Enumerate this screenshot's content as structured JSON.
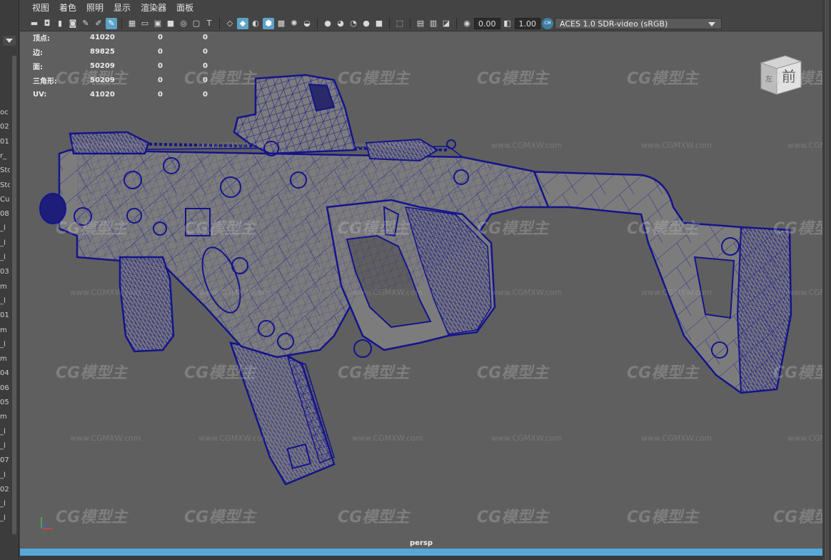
{
  "menu": [
    "视图",
    "着色",
    "照明",
    "显示",
    "渲染器",
    "面板"
  ],
  "toolbar": {
    "exposure": "0.00",
    "gamma": "1.00",
    "color_space": "ACES 1.0 SDR-video (sRGB)",
    "cs_icon": "CM"
  },
  "hud": {
    "rows": [
      {
        "label": "顶点:",
        "v1": "41020",
        "v2": "0",
        "v3": "0"
      },
      {
        "label": "边:",
        "v1": "89825",
        "v2": "0",
        "v3": "0"
      },
      {
        "label": "面:",
        "v1": "50209",
        "v2": "0",
        "v3": "0"
      },
      {
        "label": "三角形:",
        "v1": "50209",
        "v2": "0",
        "v3": "0"
      },
      {
        "label": "UV:",
        "v1": "41020",
        "v2": "0",
        "v3": "0"
      }
    ]
  },
  "viewcube": {
    "face": "前",
    "side": "左"
  },
  "camera": "persp",
  "watermark": {
    "logo": "CG模型主",
    "url": "www.CGMXW.com"
  },
  "outliner_fragments": [
    "oc",
    "02",
    "01",
    "r_",
    "Stc",
    "Stc",
    "Cu",
    "08",
    "_l",
    "_l",
    "_l",
    "03",
    "m",
    "_l",
    "01",
    "m",
    "_l",
    "m",
    "04",
    "06",
    "05",
    "m",
    "_l",
    "_l",
    "07",
    "_l",
    "02",
    "_l",
    "_l"
  ],
  "colors": {
    "wire": "#14148c",
    "mesh": "#808080",
    "viewport": "#5f5f5f",
    "accent": "#55a8d8"
  }
}
